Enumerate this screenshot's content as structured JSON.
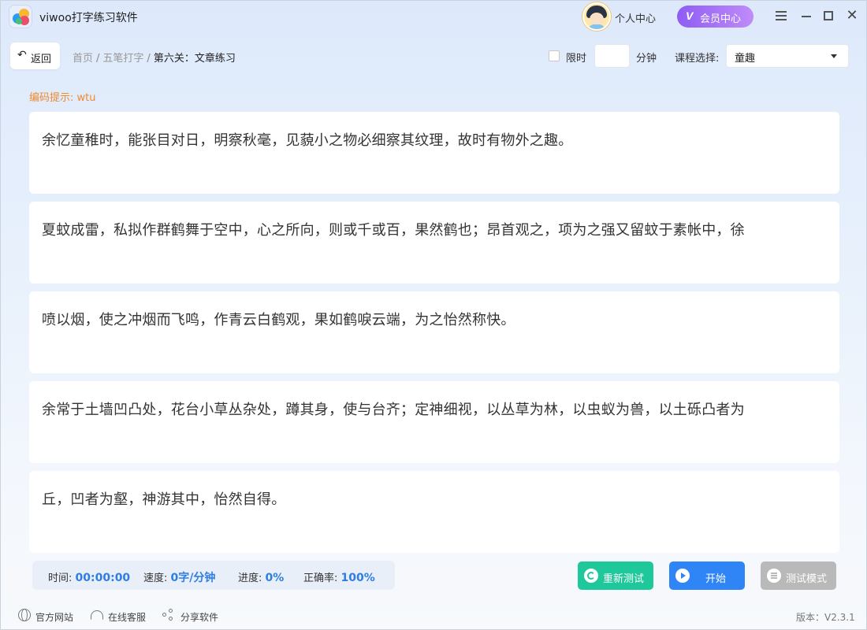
{
  "app": {
    "title": "viwoo打字练习软件"
  },
  "header": {
    "personal_center": "个人中心",
    "vip_label": "会员中心",
    "vip_badge": "V"
  },
  "toolbar": {
    "back_label": "返回",
    "breadcrumb": [
      "首页",
      "五笔打字",
      "第六关：文章练习"
    ],
    "breadcrumb_sep": "/",
    "limit_label": "限时",
    "minutes_value": "",
    "minutes_label": "分钟",
    "course_label": "课程选择:",
    "course_value": "童趣"
  },
  "hint": {
    "text": "编码提示: wtu"
  },
  "lines": [
    "余忆童稚时，能张目对日，明察秋毫，见藐小之物必细察其纹理，故时有物外之趣。",
    "夏蚊成雷，私拟作群鹤舞于空中，心之所向，则或千或百，果然鹤也；昂首观之，项为之强又留蚊于素帐中，徐",
    "喷以烟，使之冲烟而飞鸣，作青云白鹤观，果如鹤唳云端，为之怡然称快。",
    "余常于土墙凹凸处，花台小草丛杂处，蹲其身，使与台齐；定神细视，以丛草为林，以虫蚁为兽，以土砾凸者为",
    "丘，凹者为壑，神游其中，怡然自得。"
  ],
  "stats": {
    "time_label": "时间:",
    "time_value": "00:00:00",
    "speed_label": "速度:",
    "speed_value": "0字/分钟",
    "progress_label": "进度:",
    "progress_value": "0%",
    "accuracy_label": "正确率:",
    "accuracy_value": "100%"
  },
  "actions": {
    "retest": "重新测试",
    "start": "开始",
    "test_mode": "测试模式"
  },
  "footer": {
    "website": "官方网站",
    "support": "在线客服",
    "share": "分享软件",
    "version": "版本：V2.3.1"
  },
  "colors": {
    "accent": "#2f7de1",
    "hint": "#f08a2c",
    "retest": "#1fc89a",
    "start": "#2f85f5",
    "disabled": "#b9b9b9",
    "vip": "#8e5cf4"
  }
}
